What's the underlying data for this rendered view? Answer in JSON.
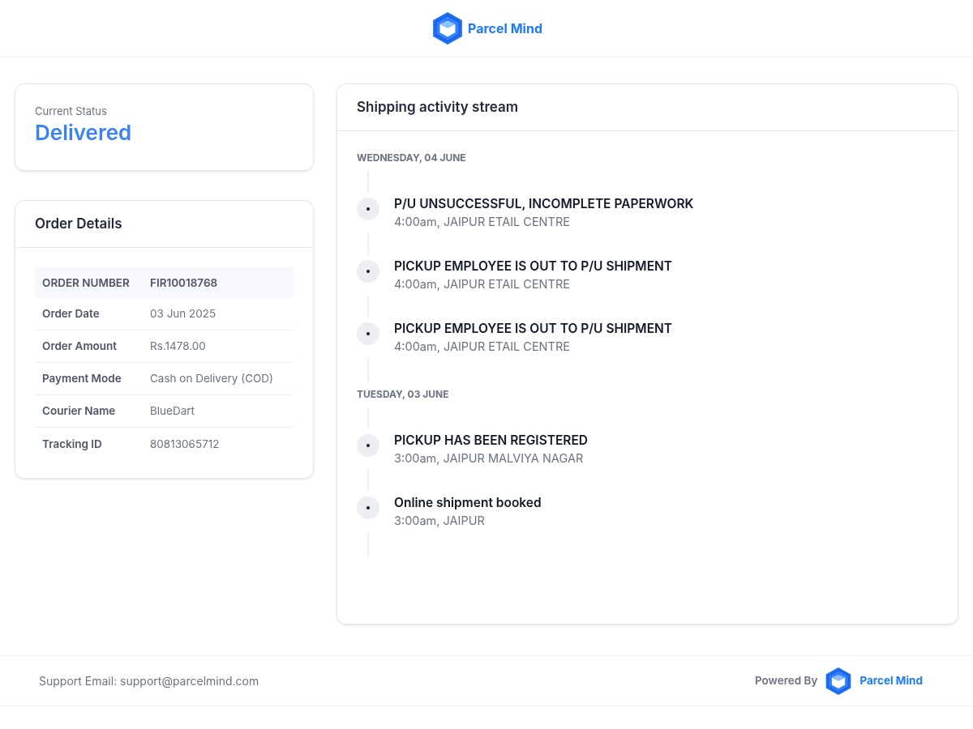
{
  "header": {
    "brand": "Parcel Mind"
  },
  "status": {
    "label": "Current Status",
    "value": "Delivered"
  },
  "order_details": {
    "title": "Order Details",
    "rows": [
      {
        "label": "ORDER NUMBER",
        "value": "FIR10018768",
        "highlighted": true
      },
      {
        "label": "Order Date",
        "value": "03 Jun 2025",
        "highlighted": false
      },
      {
        "label": "Order Amount",
        "value": "Rs.1478.00",
        "highlighted": false
      },
      {
        "label": "Payment Mode",
        "value": "Cash on Delivery (COD)",
        "highlighted": false
      },
      {
        "label": "Courier Name",
        "value": "BlueDart",
        "highlighted": false
      },
      {
        "label": "Tracking ID",
        "value": "80813065712",
        "highlighted": false
      }
    ]
  },
  "activity": {
    "title": "Shipping activity stream",
    "groups": [
      {
        "date": "WEDNESDAY, 04 JUNE",
        "events": [
          {
            "title": "P/U UNSUCCESSFUL, INCOMPLETE PAPERWORK",
            "detail": "4:00am, JAIPUR ETAIL CENTRE"
          },
          {
            "title": "PICKUP EMPLOYEE IS OUT TO P/U SHIPMENT",
            "detail": "4:00am, JAIPUR ETAIL CENTRE"
          },
          {
            "title": "PICKUP EMPLOYEE IS OUT TO P/U SHIPMENT",
            "detail": "4:00am, JAIPUR ETAIL CENTRE"
          }
        ]
      },
      {
        "date": "TUESDAY, 03 JUNE",
        "events": [
          {
            "title": "PICKUP HAS BEEN REGISTERED",
            "detail": "3:00am, JAIPUR MALVIYA NAGAR"
          },
          {
            "title": "Online shipment booked",
            "detail": "3:00am, JAIPUR"
          }
        ]
      }
    ]
  },
  "footer": {
    "support_label": "Support Email:",
    "support_email": "support@parcelmind.com",
    "powered_by": "Powered By",
    "brand": "Parcel Mind"
  }
}
